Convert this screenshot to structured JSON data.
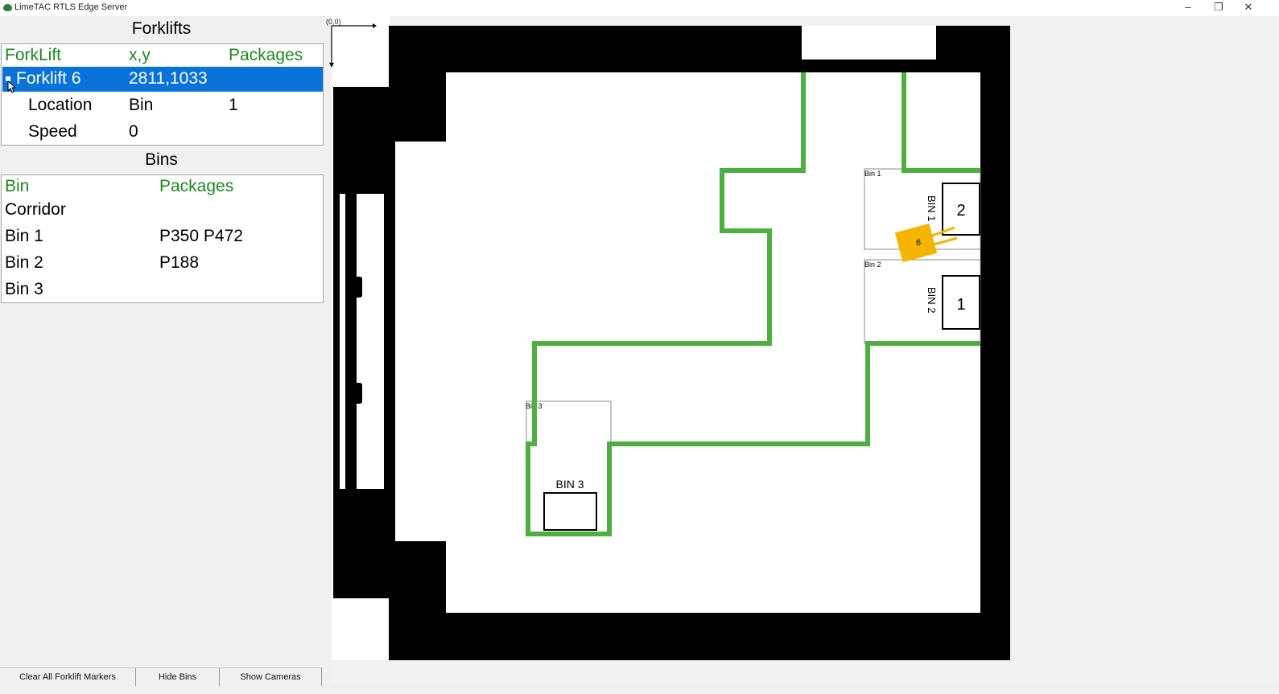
{
  "window": {
    "title": "LimeTAC RTLS Edge Server",
    "minimize": "–",
    "restore": "❐",
    "close": "✕"
  },
  "forklifts": {
    "title": "Forklifts",
    "columns": [
      "ForkLift",
      "x,y",
      "Packages"
    ],
    "selected": {
      "name": "Forklift 6",
      "xy": "2811,1033"
    },
    "details": [
      {
        "label": "Location",
        "value": "Bin",
        "extra": "1"
      },
      {
        "label": "Speed",
        "value": "0",
        "extra": ""
      }
    ]
  },
  "bins": {
    "title": "Bins",
    "columns": [
      "Bin",
      "Packages"
    ],
    "rows": [
      {
        "bin": "Corridor",
        "packages": ""
      },
      {
        "bin": "Bin 1",
        "packages": "P350 P472"
      },
      {
        "bin": "Bin 2",
        "packages": "P188"
      },
      {
        "bin": "Bin 3",
        "packages": ""
      }
    ]
  },
  "buttons": {
    "clear": "Clear All Forklift Markers",
    "hide_bins": "Hide Bins",
    "show_cameras": "Show Cameras"
  },
  "map": {
    "origin": "(0,0)",
    "bin1_small": "Bin 1",
    "bin2_small": "Bin 2",
    "bin3_small": "Bin 3",
    "bin1_label": "BIN 1",
    "bin2_label": "BIN 2",
    "bin3_label": "BIN 3",
    "bin1_count": "2",
    "bin2_count": "1",
    "forklift_marker": "6",
    "colors": {
      "path": "#4caf3f",
      "forklift": "#f5b400",
      "wall": "#000000"
    }
  }
}
